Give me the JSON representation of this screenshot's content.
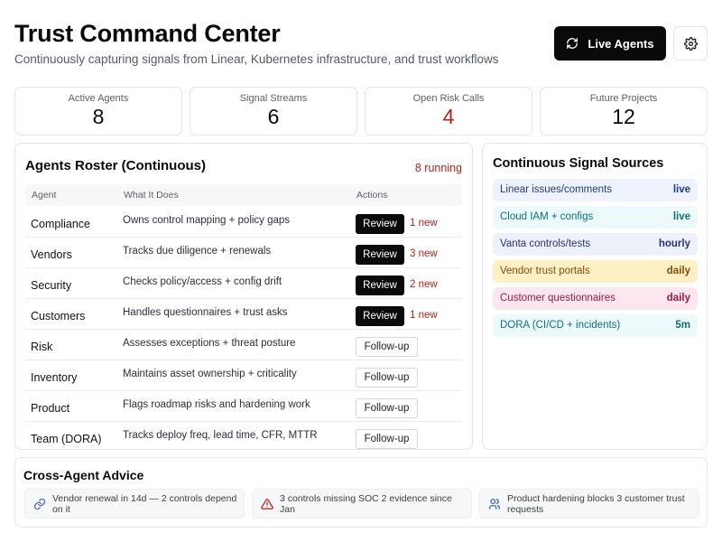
{
  "header": {
    "title": "Trust Command Center",
    "subtitle": "Continuously capturing signals from Linear, Kubernetes infrastructure, and trust workflows",
    "live_button_label": "Live Agents",
    "live_button_icon": "refresh-icon",
    "settings_icon": "gear-icon"
  },
  "stats": [
    {
      "label": "Active Agents",
      "value": "8"
    },
    {
      "label": "Signal Streams",
      "value": "6"
    },
    {
      "label": "Open Risk Calls",
      "value": "4",
      "color": "#b42318"
    },
    {
      "label": "Future Projects",
      "value": "12"
    }
  ],
  "roster": {
    "title": "Agents Roster (Continuous)",
    "running": "8 running",
    "columns": [
      "Agent",
      "What It Does",
      "Actions"
    ],
    "rows": [
      {
        "agent": "Compliance",
        "desc": "Owns control mapping + policy gaps",
        "action": "Review",
        "new": "1 new"
      },
      {
        "agent": "Vendors",
        "desc": "Tracks due diligence + renewals",
        "action": "Review",
        "new": "3 new"
      },
      {
        "agent": "Security",
        "desc": "Checks policy/access + config drift",
        "action": "Review",
        "new": "2 new"
      },
      {
        "agent": "Customers",
        "desc": "Handles questionnaires + trust asks",
        "action": "Review",
        "new": "1 new"
      },
      {
        "agent": "Risk",
        "desc": "Assesses exceptions + threat posture",
        "action": "Follow-up",
        "new": ""
      },
      {
        "agent": "Inventory",
        "desc": "Maintains asset ownership + criticality",
        "action": "Follow-up",
        "new": ""
      },
      {
        "agent": "Product",
        "desc": "Flags roadmap risks and hardening work",
        "action": "Follow-up",
        "new": ""
      },
      {
        "agent": "Team (DORA)",
        "desc": "Tracks deploy freq, lead time, CFR, MTTR",
        "action": "Follow-up",
        "new": ""
      }
    ]
  },
  "sources": {
    "title": "Continuous Signal Sources",
    "items": [
      {
        "name": "Linear issues/comments",
        "freq": "live",
        "bg": "#eef3fd",
        "fg": "#1e3a8a"
      },
      {
        "name": "Cloud IAM + configs",
        "freq": "live",
        "bg": "#ecfafc",
        "fg": "#0e6f7f"
      },
      {
        "name": "Vanta controls/tests",
        "freq": "hourly",
        "bg": "#eef1fa",
        "fg": "#27327a"
      },
      {
        "name": "Vendor trust portals",
        "freq": "daily",
        "bg": "#fdf0c4",
        "fg": "#8a4a0b"
      },
      {
        "name": "Customer questionnaires",
        "freq": "daily",
        "bg": "#fce7ef",
        "fg": "#9d1749"
      },
      {
        "name": "DORA (CI/CD + incidents)",
        "freq": "5m",
        "bg": "#ecfafc",
        "fg": "#0e6f7f"
      }
    ]
  },
  "advice": {
    "title": "Cross-Agent Advice",
    "items": [
      {
        "icon": "link-icon",
        "text": "Vendor renewal in 14d — 2 controls depend on it",
        "color": "#4a67c9"
      },
      {
        "icon": "warning-icon",
        "text": "3 controls missing SOC 2 evidence since Jan",
        "color": "#b42318"
      },
      {
        "icon": "users-icon",
        "text": "Product hardening blocks 3 customer trust requests",
        "color": "#3b63c9"
      }
    ]
  }
}
